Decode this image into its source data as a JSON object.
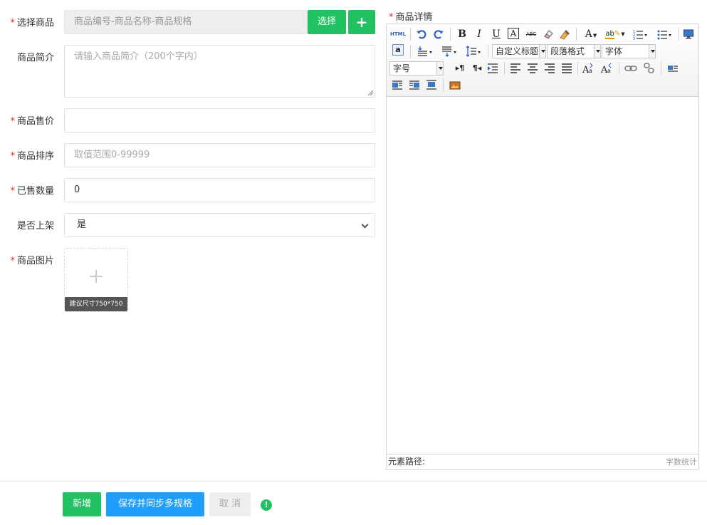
{
  "form": {
    "product": {
      "label": "选择商品",
      "placeholder": "商品编号-商品名称-商品规格",
      "select_button": "选择",
      "add_icon": "+"
    },
    "intro": {
      "label": "商品简介",
      "placeholder": "请输入商品简介（200个字内）"
    },
    "price": {
      "label": "商品售价",
      "value": ""
    },
    "sort": {
      "label": "商品排序",
      "placeholder": "取值范围0-99999"
    },
    "sold": {
      "label": "已售数量",
      "value": "0"
    },
    "onsale": {
      "label": "是否上架",
      "selected": "是"
    },
    "image": {
      "label": "商品图片",
      "tip": "建议尺寸750*750"
    },
    "required_mark": "*"
  },
  "editor": {
    "label": "商品详情",
    "toolbar": {
      "html": "HTML",
      "bold": "B",
      "italic": "I",
      "underline": "U",
      "font_border": "A",
      "strike": "ABC",
      "font_color": "A",
      "back_color": "ab",
      "custom_title": "自定义标题",
      "paragraph": "段落格式",
      "font_family": "字体",
      "font_size": "字号",
      "symbol": "a",
      "ltr": "▸¶",
      "rtl": "¶◂"
    },
    "footer": {
      "path_label": "元素路径:",
      "word_count": "字数统计"
    }
  },
  "actions": {
    "add": "新增",
    "save_sync": "保存并同步多规格",
    "cancel": "取 消",
    "info_icon": "!"
  },
  "colors": {
    "green": "#22c263",
    "blue": "#1e9fff",
    "required": "#e0302e"
  }
}
